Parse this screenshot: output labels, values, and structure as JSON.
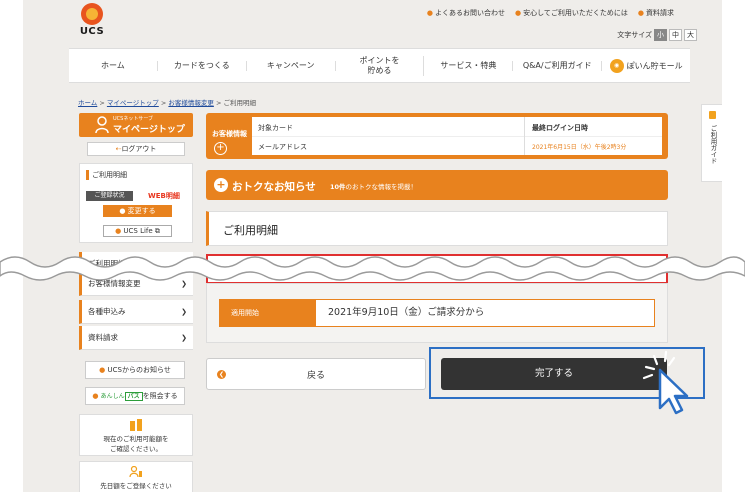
{
  "header": {
    "logo_text": "UCS",
    "top_links": [
      "よくあるお問い合わせ",
      "安心してご利用いただくためには",
      "資料請求"
    ],
    "font_size_label": "文字サイズ",
    "font_sizes": [
      "小",
      "中",
      "大"
    ]
  },
  "nav": {
    "items": [
      {
        "label": "ホーム"
      },
      {
        "label": "カードをつくる"
      },
      {
        "label": "キャンペーン"
      },
      {
        "label": "ポイントを\n貯める"
      },
      {
        "label": "サービス・特典"
      },
      {
        "label": "Q&A/ご利用ガイド"
      },
      {
        "label": "ぽいん貯モール"
      }
    ]
  },
  "breadcrumb": {
    "links": [
      "ホーム",
      "マイページトップ",
      "お客様情報変更"
    ],
    "separator": " > ",
    "current": "ご利用明細"
  },
  "sidebar": {
    "head_sub": "UCSネットサーブ",
    "head_main": "マイページトップ",
    "logout": "ログアウト",
    "box_title": "ご利用明細",
    "status_label": "ご登録状況",
    "status_value": "WEB明細",
    "change_button": "変更する",
    "life_button": "UCS Life",
    "list_items": [
      "ご利用明細",
      "お客様情報変更",
      "各種申込み",
      "資料請求"
    ],
    "notice_button": "UCSからのお知らせ",
    "pass_prefix": "あんしん",
    "pass_logo": "パス",
    "pass_button_suffix": "を照会する",
    "card1_line1": "現在のご利用可能額を",
    "card1_line2": "ご確認ください。",
    "card2_line1": "先日額をご登録ください"
  },
  "customer_info": {
    "label": "お客様情報",
    "target_card_label": "対象カード",
    "email_label": "メールアドレス",
    "last_login_label": "最終ログイン日時",
    "last_login_value": "2021年6月15日（水）午後2時3分"
  },
  "notice_bar": {
    "title": "おトクなお知らせ",
    "sub_count": "10件",
    "sub_text": "のおトクな情報を掲載！"
  },
  "main": {
    "page_title": "ご利用明細",
    "period_label": "適用開始",
    "period_value": "2021年9月10日（金）ご請求分から",
    "back_button": "戻る",
    "done_button": "完了する"
  },
  "side_tab": {
    "label": "ご利用ガイド"
  }
}
